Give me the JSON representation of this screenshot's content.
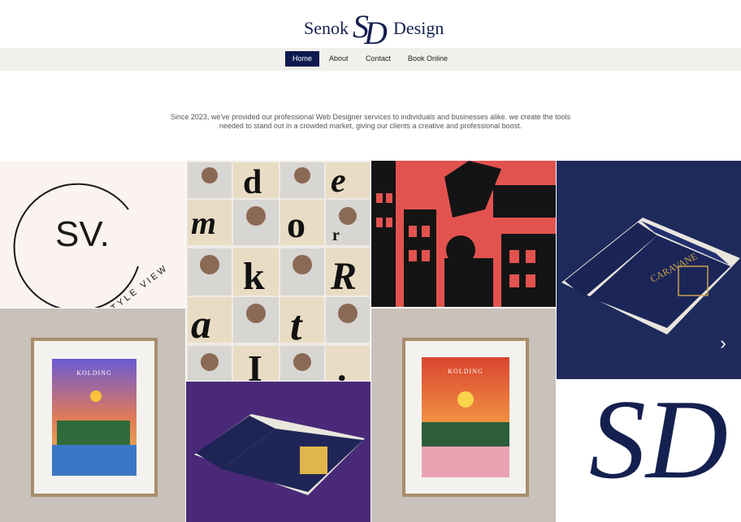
{
  "brand": {
    "left": "Senok",
    "right": "Design",
    "monogram": "SD"
  },
  "nav": {
    "items": [
      {
        "label": "Home",
        "active": true
      },
      {
        "label": "About",
        "active": false
      },
      {
        "label": "Contact",
        "active": false
      },
      {
        "label": "Book Online",
        "active": false
      }
    ]
  },
  "intro": {
    "line1": "Since 2023, we've provided our professional Web Designer services to individuals and businesses alike. we create the tools",
    "line2": "needed to stand out in a crowded market, giving our clients a creative and professional boost."
  },
  "gallery": {
    "sv_logo": {
      "monogram": "SV.",
      "ring_text": "STYLE VIEW"
    },
    "letters": [
      "d",
      "e",
      "m",
      "o",
      "r",
      "k",
      "R",
      "a",
      "t",
      "I",
      "."
    ],
    "poster1_title": "KOLDING",
    "poster2_title": "KOLDING",
    "book_title": "CARAVANE",
    "sd_monogram": "SD"
  },
  "colors": {
    "navy": "#0e1a4f",
    "nav_bg": "#f1f0ec",
    "coral": "#e2534f",
    "purple": "#4a2a78",
    "book_navy": "#1f2a5c",
    "taupe": "#c9c1ba"
  },
  "controls": {
    "next_icon": "chevron-right-icon"
  }
}
